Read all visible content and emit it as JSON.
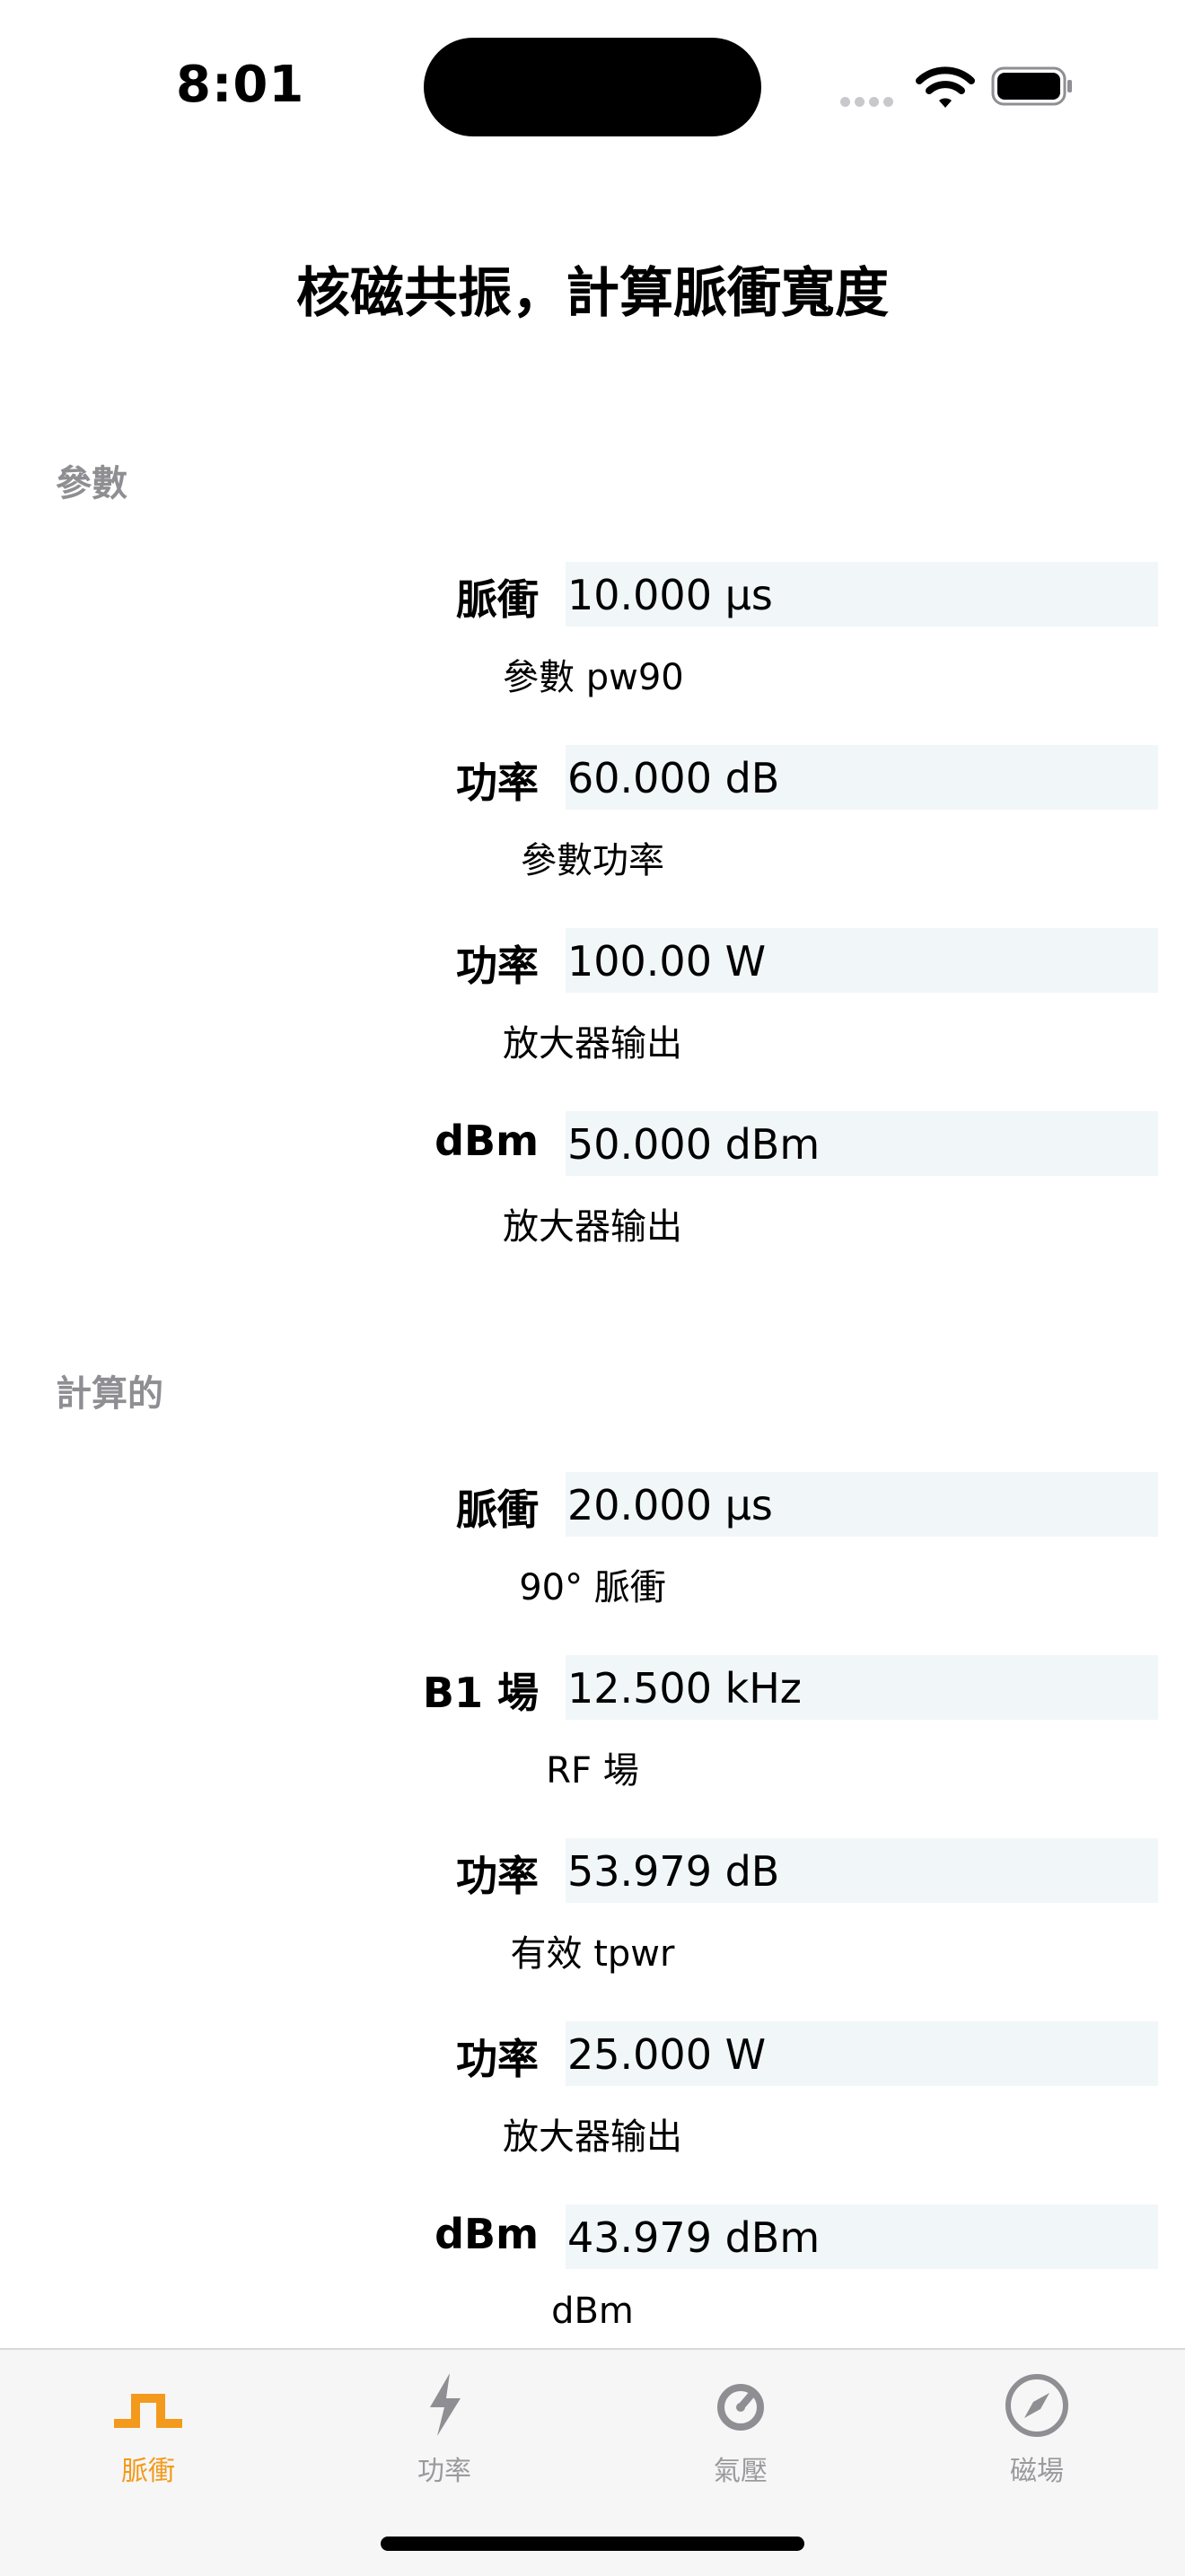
{
  "status": {
    "time": "8:01"
  },
  "page": {
    "title": "核磁共振，計算脈衝寬度"
  },
  "sections": {
    "params": "參數",
    "computed": "計算的"
  },
  "params": [
    {
      "label": "脈衝",
      "value": "10.000 μs",
      "sub": "參數 pw90"
    },
    {
      "label": "功率",
      "value": "60.000 dB",
      "sub": "參數功率"
    },
    {
      "label": "功率",
      "value": "100.00 W",
      "sub": "放大器输出"
    },
    {
      "label": "dBm",
      "value": "50.000 dBm",
      "sub": "放大器输出"
    }
  ],
  "computed": [
    {
      "label": "脈衝",
      "value": "20.000 μs",
      "sub": "90° 脈衝"
    },
    {
      "label": "B1 場",
      "value": "12.500 kHz",
      "sub": "RF 場"
    },
    {
      "label": "功率",
      "value": "53.979 dB",
      "sub": "有效 tpwr"
    },
    {
      "label": "功率",
      "value": "25.000 W",
      "sub": "放大器输出"
    },
    {
      "label": "dBm",
      "value": "43.979 dBm",
      "sub": "dBm"
    }
  ],
  "tabs": [
    {
      "label": "脈衝",
      "icon": "pulse-icon",
      "active": true
    },
    {
      "label": "功率",
      "icon": "lightning-icon",
      "active": false
    },
    {
      "label": "氣壓",
      "icon": "gauge-icon",
      "active": false
    },
    {
      "label": "磁場",
      "icon": "compass-icon",
      "active": false
    }
  ],
  "colors": {
    "accent": "#f39a1c",
    "inactive": "#9a9a9e",
    "field_bg": "#f1f6f9"
  }
}
